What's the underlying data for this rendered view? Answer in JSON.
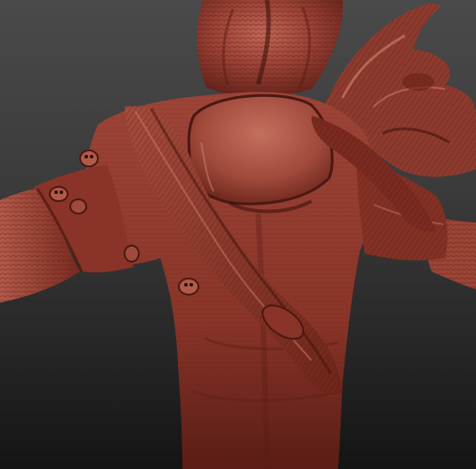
{
  "scene": {
    "subject": "sculpted-character-bust",
    "material_colors": {
      "base": "#8a3328",
      "mid": "#a2473a",
      "highlight": "#c46a5a",
      "shadow": "#4a1812",
      "deep_shadow": "#2a0b08"
    },
    "background_colors": {
      "top": "#4a4a4a",
      "bottom": "#141414"
    }
  }
}
